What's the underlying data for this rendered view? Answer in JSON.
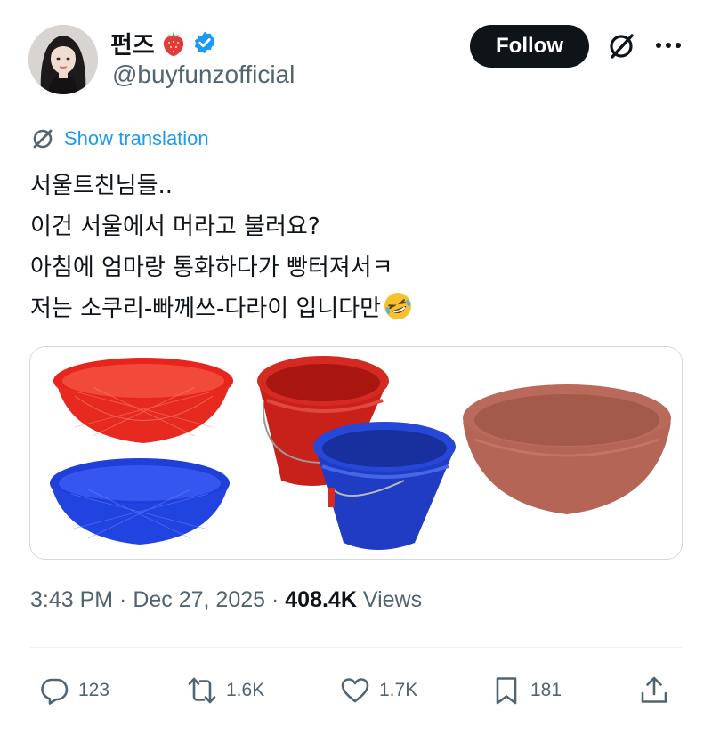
{
  "author": {
    "display_name": "펀즈",
    "name_emoji": "strawberry",
    "verified": true,
    "handle": "@buyfunzofficial"
  },
  "header": {
    "follow_label": "Follow",
    "grok_icon": "grok-icon",
    "more_icon": "more-icon"
  },
  "translation": {
    "label": "Show translation",
    "icon": "globe-icon"
  },
  "tweet": {
    "lines": [
      "서울트친님들..",
      "이건 서울에서 머라고 불러요?",
      "아침에 엄마랑 통화하다가 빵터져서ㅋ",
      "저는 소쿠리-빠께쓰-다라이 입니다만"
    ],
    "trailing_emoji": "rolling-on-the-floor-laughing"
  },
  "media": {
    "items": [
      "red basket",
      "blue basket",
      "red bucket",
      "blue bucket",
      "brown basin"
    ]
  },
  "meta": {
    "time": "3:43 PM",
    "separator": " · ",
    "date": "Dec 27, 2025",
    "views_count": "408.4K",
    "views_label": "Views"
  },
  "actions": {
    "replies": "123",
    "reposts": "1.6K",
    "likes": "1.7K",
    "bookmarks": "181"
  },
  "colors": {
    "text": "#0f1419",
    "secondary": "#536471",
    "link": "#1d9bf0",
    "verified": "#1d9bf0",
    "follow_bg": "#0f1419"
  }
}
